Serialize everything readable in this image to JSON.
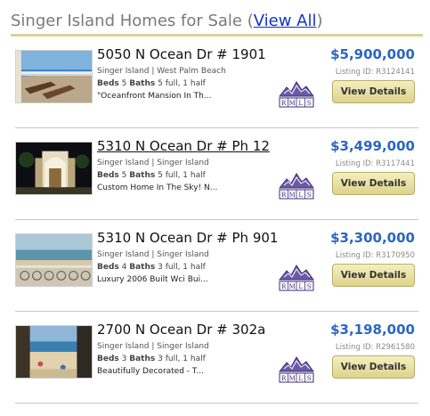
{
  "header": {
    "title": "Singer Island Homes for Sale",
    "open_paren": " (",
    "view_all": "View All",
    "close_paren": ")"
  },
  "listings": [
    {
      "address": "5050 N Ocean Dr # 1901",
      "location": "Singer Island | West Palm Beach",
      "beds": "5",
      "baths": "5 full, 1 half",
      "description": "\"Oceanfront Mansion In Th...",
      "price": "$5,900,000",
      "listing_id": "Listing ID: R3124141",
      "button": "View Details",
      "thumb": "balcony-lounge-chairs"
    },
    {
      "address": "5310 N Ocean Dr # Ph 12",
      "location": "Singer Island | Singer Island",
      "beds": "5",
      "baths": "5 full, 1 half",
      "description": "Custom Home In The Sky! N...",
      "price": "$3,499,000",
      "listing_id": "Listing ID: R3117441",
      "button": "View Details",
      "thumb": "night-entrance"
    },
    {
      "address": "5310 N Ocean Dr # Ph 901",
      "location": "Singer Island | Singer Island",
      "beds": "4",
      "baths": "3 full, 1 half",
      "description": "Luxury 2006 Built Wci Bui...",
      "price": "$3,300,000",
      "listing_id": "Listing ID: R3170950",
      "button": "View Details",
      "thumb": "ocean-railing"
    },
    {
      "address": "2700 N Ocean Dr # 302a",
      "location": "Singer Island | Singer Island",
      "beds": "3",
      "baths": "3 full, 1 half",
      "description": "Beautifully Decorated - T...",
      "price": "$3,198,000",
      "listing_id": "Listing ID: R2961580",
      "button": "View Details",
      "thumb": "beach-view"
    }
  ],
  "labels": {
    "beds": "Beds",
    "baths": "Baths",
    "rmls": "RMLS"
  },
  "colors": {
    "accent_price": "#2b66c4",
    "button_bg": "#e6dda0",
    "header_rule": "#d9d39a",
    "link": "#1133cc"
  }
}
